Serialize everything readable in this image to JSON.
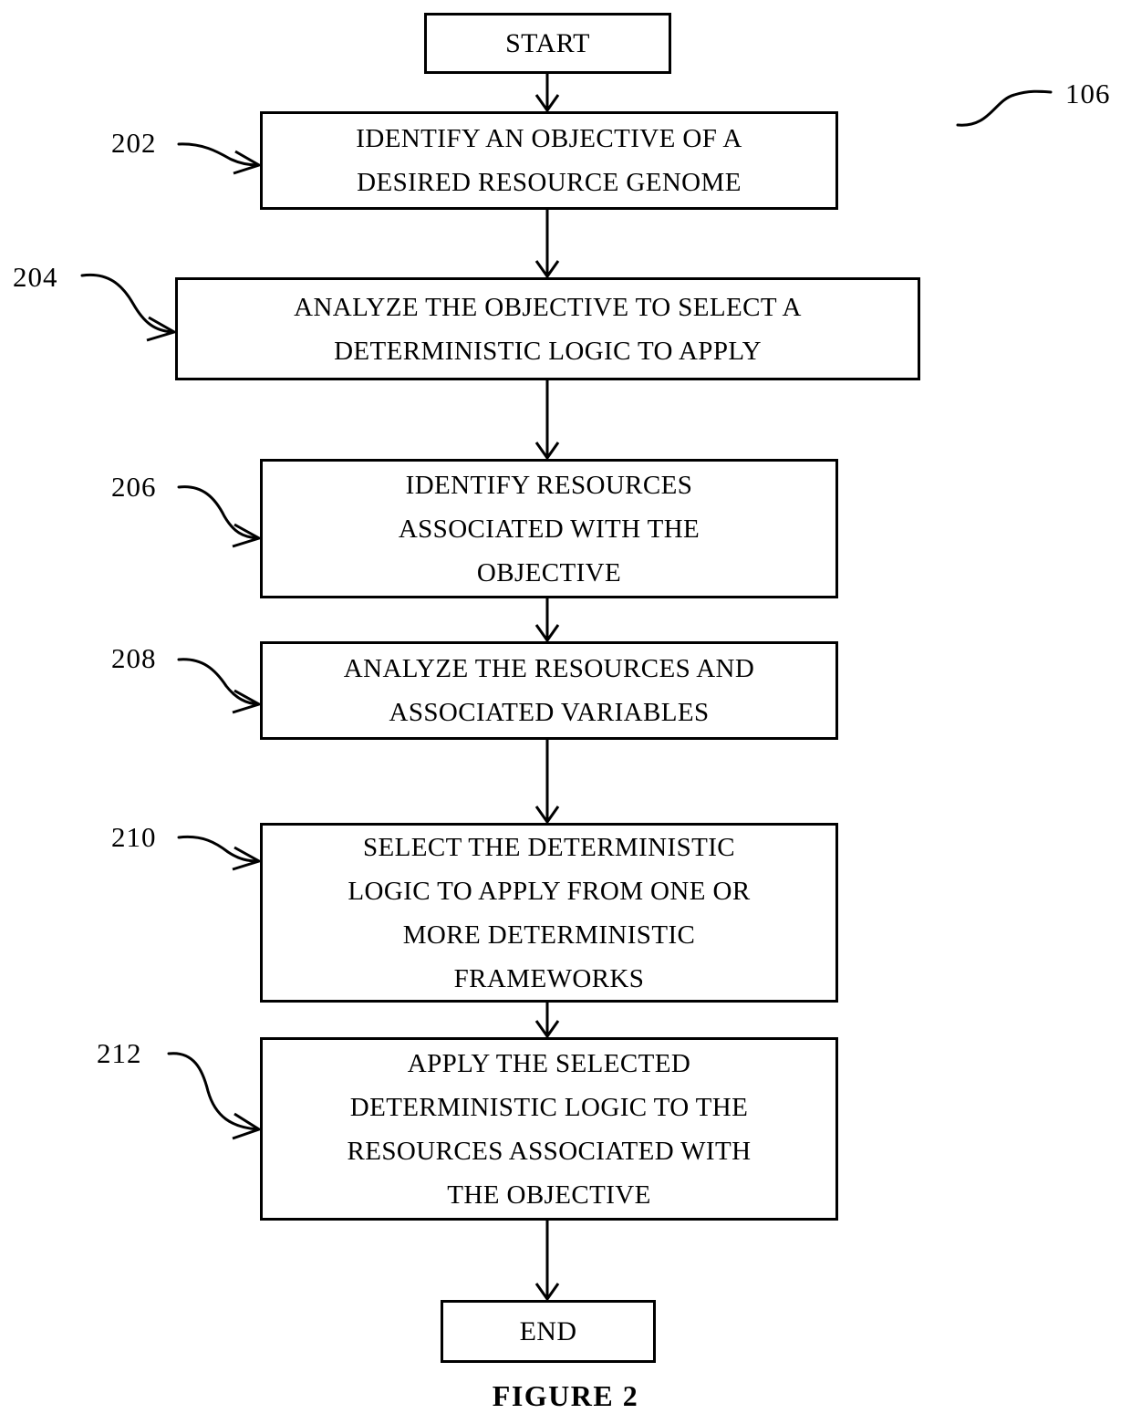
{
  "figure": {
    "caption": "FIGURE 2",
    "diagram_ref": "106"
  },
  "flowchart": {
    "type": "flowchart",
    "orientation": "top-to-bottom",
    "nodes": [
      {
        "id": "start",
        "shape": "rectangle",
        "ref": "",
        "text": "START"
      },
      {
        "id": "step-202",
        "shape": "rectangle",
        "ref": "202",
        "text": "IDENTIFY AN OBJECTIVE  OF A\nDESIRED RESOURCE GENOME"
      },
      {
        "id": "step-204",
        "shape": "rectangle",
        "ref": "204",
        "text": "ANALYZE THE OBJECTIVE TO SELECT A\nDETERMINISTIC LOGIC TO APPLY"
      },
      {
        "id": "step-206",
        "shape": "rectangle",
        "ref": "206",
        "text": "IDENTIFY RESOURCES\nASSOCIATED WITH THE\nOBJECTIVE"
      },
      {
        "id": "step-208",
        "shape": "rectangle",
        "ref": "208",
        "text": "ANALYZE THE RESOURCES AND\nASSOCIATED VARIABLES"
      },
      {
        "id": "step-210",
        "shape": "rectangle",
        "ref": "210",
        "text": "SELECT THE DETERMINISTIC\nLOGIC TO APPLY FROM ONE OR\nMORE DETERMINISTIC\nFRAMEWORKS"
      },
      {
        "id": "step-212",
        "shape": "rectangle",
        "ref": "212",
        "text": "APPLY THE SELECTED\nDETERMINISTIC LOGIC TO THE\nRESOURCES ASSOCIATED WITH\nTHE OBJECTIVE"
      },
      {
        "id": "end",
        "shape": "rectangle",
        "ref": "",
        "text": "END"
      }
    ],
    "edges": [
      {
        "from": "start",
        "to": "step-202",
        "style": "arrow"
      },
      {
        "from": "step-202",
        "to": "step-204",
        "style": "arrow"
      },
      {
        "from": "step-204",
        "to": "step-206",
        "style": "arrow"
      },
      {
        "from": "step-206",
        "to": "step-208",
        "style": "arrow"
      },
      {
        "from": "step-208",
        "to": "step-210",
        "style": "arrow"
      },
      {
        "from": "step-210",
        "to": "step-212",
        "style": "arrow"
      },
      {
        "from": "step-212",
        "to": "end",
        "style": "arrow"
      }
    ]
  },
  "colors": {
    "stroke": "#000000",
    "background": "#ffffff"
  }
}
